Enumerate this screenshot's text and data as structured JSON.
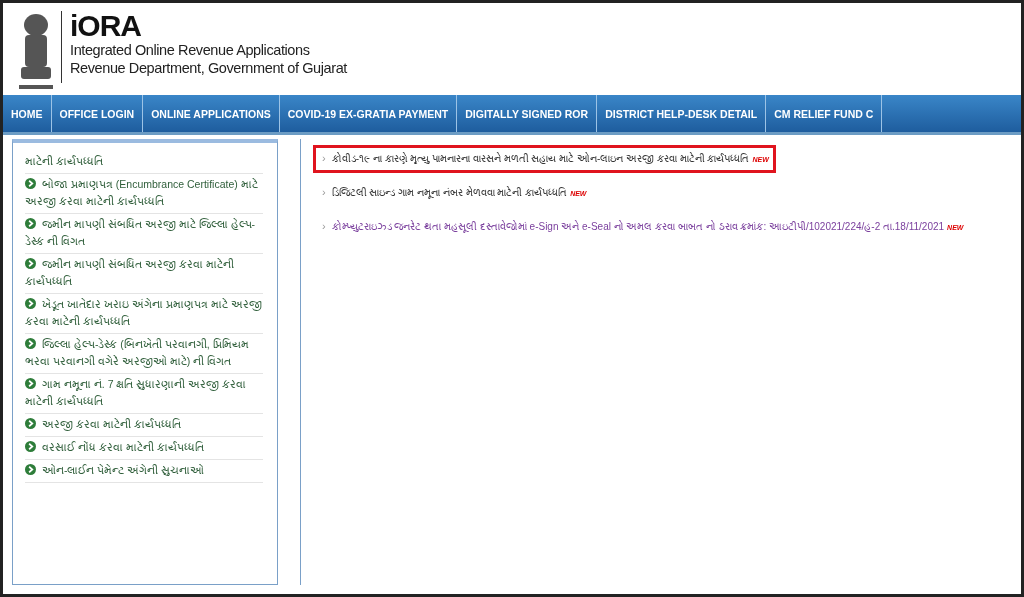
{
  "header": {
    "title": "iORA",
    "subtitle_1": "Integrated Online Revenue Applications",
    "subtitle_2": "Revenue Department, Government of Gujarat"
  },
  "nav": [
    {
      "label": "HOME"
    },
    {
      "label": "OFFICE LOGIN"
    },
    {
      "label": "ONLINE APPLICATIONS"
    },
    {
      "label": "COVID-19 EX-GRATIA PAYMENT"
    },
    {
      "label": "DIGITALLY SIGNED ROR"
    },
    {
      "label": "DISTRICT HELP-DESK DETAIL"
    },
    {
      "label": "CM RELIEF FUND C"
    }
  ],
  "sidebar": {
    "items": [
      {
        "text": "માટેની કાર્યપધ્ધતિ",
        "bullet": false
      },
      {
        "text": "બોજા પ્રમાણપત્ર (Encumbrance Certificate) માટે અરજી કરવા માટેની કાર્યપધ્ધતિ",
        "bullet": true
      },
      {
        "text": "જમીન માપણી સંબધિત અરજી માટે જિલ્લા હેલ્પ-ડેસ્ક ની વિગત",
        "bullet": true
      },
      {
        "text": "જમીન માપણી સંબધિત અરજી કરવા માટેની કાર્યપધ્ધતિ",
        "bullet": true
      },
      {
        "text": "ખેડૂત ખાતેદાર ખરાઇ અંગેના પ્રમાણપત્ર માટે અરજી કરવા માટેની કાર્યપધ્ધતિ",
        "bullet": true
      },
      {
        "text": "જિલ્લા હેલ્પ-ડેસ્ક (બિનખેતી પરવાનગી, પ્રિમિયમ ભરવા પરવાનગી વગેરે અરજીઓ માટે) ની વિગત",
        "bullet": true
      },
      {
        "text": "ગામ નમૂના નં. 7 ક્ષતિ સુધારણાની અરજી કરવા માટેની કાર્યપધ્ધતિ",
        "bullet": true
      },
      {
        "text": "અરજી કરવા માટેની કાર્યપધ્ધતિ",
        "bullet": true
      },
      {
        "text": "વરસાઈ નોંધ કરવા માટેની કાર્યપધ્ધતિ",
        "bullet": true
      },
      {
        "text": "ઓન-લાઈન પેમેન્ટ અંગેની સુચનાઓ",
        "bullet": true
      }
    ]
  },
  "news": [
    {
      "marker": "›",
      "text": "કોવીડ-૧૯ ના કારણે મૃત્યુ પામનારના વારસને મળતી સહાય માટે ઓન-લાઇન અરજી કરવા માટેની કાર્યપધ્ધતિ",
      "badge": "NEW",
      "highlighted": true,
      "visited": false
    },
    {
      "marker": "›",
      "text": "ડિજિટલી સાઇન્ડ ગામ નમૂના નંબર મેળવવા માટેની કાર્યપધ્ધતિ",
      "badge": "NEW",
      "highlighted": false,
      "visited": false
    },
    {
      "marker": "›",
      "text": "કોમ્પ્યુટરાઇઝ્ડ જનરેટ થતા મહસૂલી દસ્તાવેજોમાં e-Sign અને e-Seal નો અમલ કરવા બાબત નો ઠરાવ ક્રમાંક: આઇટીપી/102021/224/હ-2 તા.18/11/2021",
      "badge": "NEW",
      "highlighted": false,
      "visited": true
    }
  ]
}
